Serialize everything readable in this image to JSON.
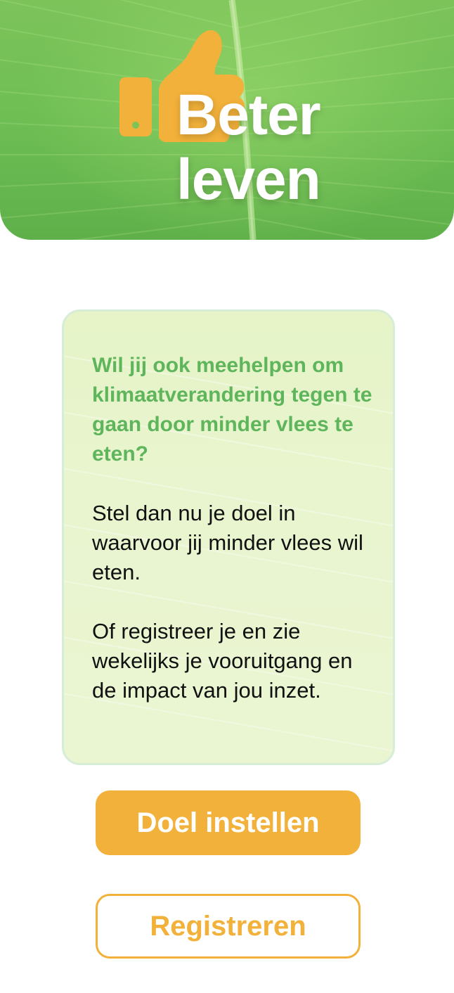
{
  "header": {
    "title_line1": "Beter",
    "title_line2": "leven",
    "logo_icon": "thumbs-up-icon",
    "background": "green-leaf",
    "accent_color": "#f2b13a",
    "green_color": "#6fbf55"
  },
  "card": {
    "lead": "Wil jij ook meehelpen om klimaatverandering tegen te gaan door minder vlees te eten?",
    "paragraph1": "Stel dan nu je doel in waarvoor jij minder vlees wil eten.",
    "paragraph2": "Of registreer je en zie wekelijks je vooruitgang en de impact van jou inzet.",
    "lead_color": "#5fb55c"
  },
  "actions": {
    "set_goal_label": "Doel instellen",
    "register_label": "Registreren"
  }
}
